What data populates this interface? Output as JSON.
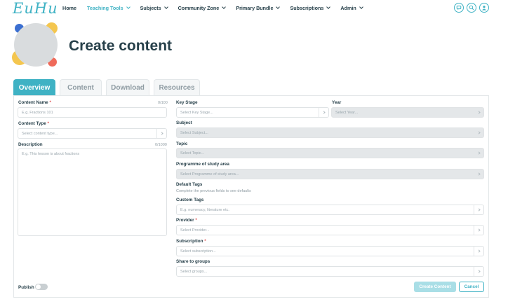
{
  "nav": {
    "logo": "EuHu",
    "items": [
      {
        "label": "Home",
        "dropdown": false
      },
      {
        "label": "Teaching Tools",
        "dropdown": true,
        "active": true
      },
      {
        "label": "Subjects",
        "dropdown": true
      },
      {
        "label": "Community Zone",
        "dropdown": true
      },
      {
        "label": "Primary Bundle",
        "dropdown": true
      },
      {
        "label": "Subscriptions",
        "dropdown": true
      },
      {
        "label": "Admin",
        "dropdown": true
      }
    ],
    "icons": [
      "chat-icon",
      "search-icon",
      "user-icon"
    ],
    "accent": "#3fb2c4"
  },
  "header": {
    "title": "Create content"
  },
  "tabs": [
    "Overview",
    "Content",
    "Download",
    "Resources"
  ],
  "form": {
    "content_name": {
      "label": "Content Name",
      "counter": "0/100",
      "placeholder": "E.g. Fractions 101"
    },
    "content_type": {
      "label": "Content Type",
      "placeholder": "Select content type..."
    },
    "description": {
      "label": "Description",
      "counter": "0/1000",
      "placeholder": "E.g. This lesson is about fractions"
    },
    "key_stage": {
      "label": "Key Stage",
      "placeholder": "Select Key Stage..."
    },
    "year": {
      "label": "Year",
      "placeholder": "Select Year..."
    },
    "subject": {
      "label": "Subject",
      "placeholder": "Select Subject..."
    },
    "topic": {
      "label": "Topic",
      "placeholder": "Select Topic..."
    },
    "programme": {
      "label": "Programme of study area",
      "placeholder": "Select Programme of study area..."
    },
    "default_tags": {
      "label": "Default Tags",
      "hint": "Complete the previous fields to see defaults"
    },
    "custom_tags": {
      "label": "Custom Tags",
      "placeholder": "E.g. numeracy, literature etc."
    },
    "provider": {
      "label": "Provider",
      "placeholder": "Select Provider..."
    },
    "subscription": {
      "label": "Subscription",
      "placeholder": "Select subscription..."
    },
    "share_groups": {
      "label": "Share to groups",
      "placeholder": "Select groups..."
    },
    "publish": {
      "label": "Publish",
      "on": false
    },
    "required_mark": "*"
  },
  "actions": {
    "create": "Create Content",
    "cancel": "Cancel"
  }
}
